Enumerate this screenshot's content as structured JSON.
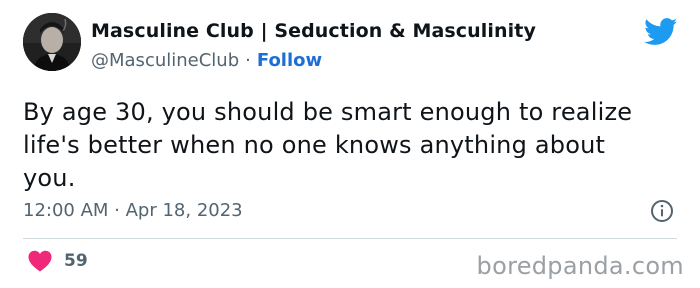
{
  "author": {
    "display_name": "Masculine Club | Seduction & Masculinity",
    "handle": "@MasculineClub",
    "separator": "·",
    "follow_label": "Follow"
  },
  "tweet": {
    "text": "By age 30, you should be smart enough to realize life's better when no one knows anything about you.",
    "timestamp": "12:00 AM · Apr 18, 2023"
  },
  "engagement": {
    "likes": "59"
  },
  "watermark": "boredpanda.com",
  "colors": {
    "twitter_blue": "#1d9bf0",
    "follow_link": "#1d6fd6",
    "heart": "#f0287a",
    "muted_text": "#536471"
  },
  "icons": {
    "brand": "twitter-bird-icon",
    "info": "info-icon",
    "like": "heart-icon"
  }
}
